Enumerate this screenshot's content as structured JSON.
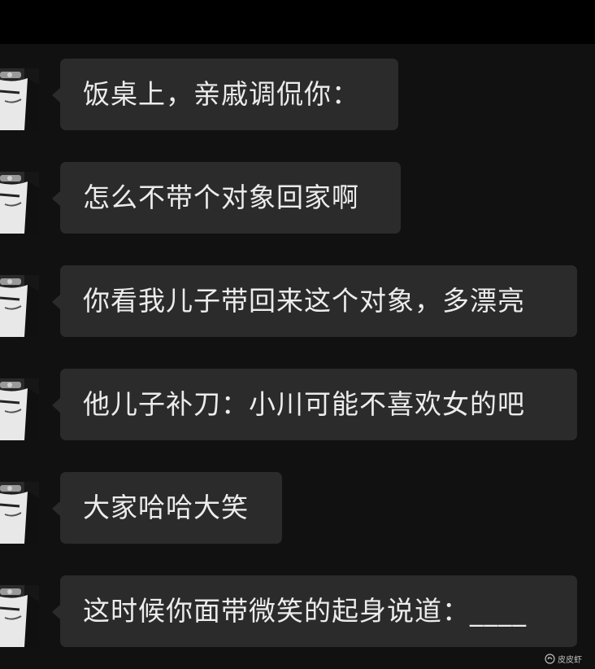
{
  "messages": [
    {
      "text": "饭桌上，亲戚调侃你："
    },
    {
      "text": "怎么不带个对象回家啊"
    },
    {
      "text": "你看我儿子带回来这个对象，多漂亮"
    },
    {
      "text": "他儿子补刀：小川可能不喜欢女的吧"
    },
    {
      "text": "大家哈哈大笑"
    },
    {
      "text": "这时候你面带微笑的起身说道：____"
    }
  ],
  "watermark": {
    "label": "皮皮虾",
    "icon": "shrimp-icon"
  },
  "colors": {
    "background": "#111111",
    "bubble": "#2b2b2b",
    "text": "#ececec"
  }
}
